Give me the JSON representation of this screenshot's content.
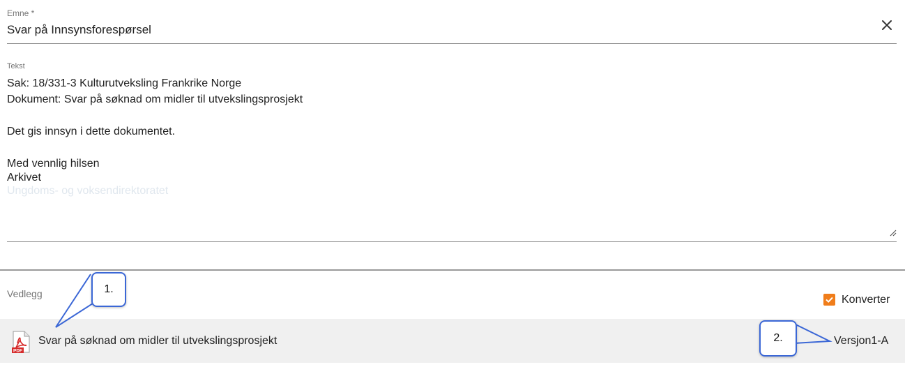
{
  "subject": {
    "label": "Emne *",
    "value": "Svar på Innsynsforespørsel"
  },
  "text": {
    "label": "Tekst",
    "lines": [
      "Sak: 18/331-3 Kulturutveksling Frankrike Norge",
      "Dokument: Svar på søknad om midler til utvekslingsprosjekt",
      "",
      "Det gis innsyn i dette dokumentet.",
      "",
      "Med vennlig hilsen",
      "Arkivet",
      "Ungdoms- og voksendirektoratet"
    ]
  },
  "attachments": {
    "label": "Vedlegg",
    "convert_label": "Konverter",
    "convert_checked": true,
    "items": [
      {
        "name": "Svar på søknad om midler til utvekslingsprosjekt",
        "version": "Versjon1-A",
        "icon": "pdf-icon"
      }
    ]
  },
  "callouts": [
    "1.",
    "2."
  ],
  "colors": {
    "accent": "#f07d1a",
    "callout_border": "#3b67d6",
    "attach_bar": "#f0f0f0"
  }
}
